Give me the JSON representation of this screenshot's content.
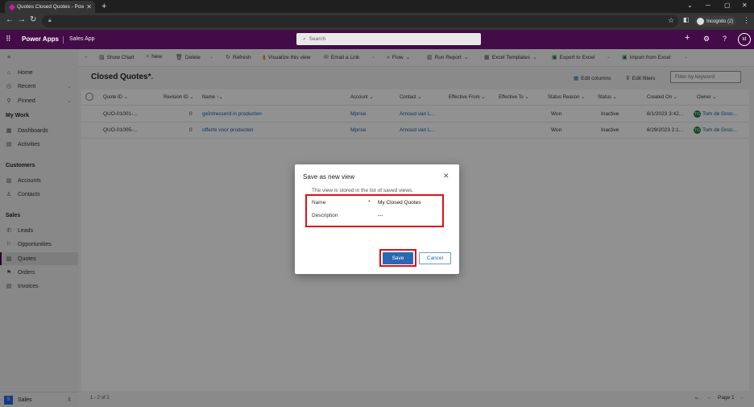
{
  "browser": {
    "tab_title": "Quotes Closed Quotes - Power A",
    "incognito_label": "Incognito (2)"
  },
  "app": {
    "name": "Power Apps",
    "sub_app": "Sales App",
    "search_placeholder": "Search",
    "user_initials": "td"
  },
  "sidebar": {
    "top_items": [
      {
        "label": "Home",
        "icon": "home-icon"
      },
      {
        "label": "Recent",
        "icon": "clock-icon",
        "chevron": true
      },
      {
        "label": "Pinned",
        "icon": "pin-icon",
        "chevron": true
      }
    ],
    "groups": [
      {
        "title": "My Work",
        "items": [
          {
            "label": "Dashboards"
          },
          {
            "label": "Activities"
          }
        ]
      },
      {
        "title": "Customers",
        "items": [
          {
            "label": "Accounts"
          },
          {
            "label": "Contacts"
          }
        ]
      },
      {
        "title": "Sales",
        "items": [
          {
            "label": "Leads"
          },
          {
            "label": "Opportunities"
          },
          {
            "label": "Quotes",
            "selected": true
          },
          {
            "label": "Orders"
          },
          {
            "label": "Invoices"
          }
        ]
      }
    ],
    "area": {
      "badge": "S",
      "label": "Sales"
    }
  },
  "commandbar": {
    "show_chart": "Show Chart",
    "new": "New",
    "delete": "Delete",
    "refresh": "Refresh",
    "visualize": "Visualize this view",
    "email_link": "Email a Link",
    "flow": "Flow",
    "run_report": "Run Report",
    "excel_templates": "Excel Templates",
    "export_excel": "Export to Excel",
    "import_excel": "Import from Excel"
  },
  "view": {
    "title": "Closed Quotes*",
    "edit_columns": "Edit columns",
    "edit_filters": "Edit filters",
    "keyword_placeholder": "Filter by keyword"
  },
  "grid": {
    "columns": [
      "Quote ID",
      "Revision ID",
      "Name",
      "Account",
      "Contact",
      "Effective From",
      "Effective To",
      "Status Reason",
      "Status",
      "Created On",
      "Owner"
    ],
    "rows": [
      {
        "quote_id": "QUO-01001-...",
        "revision": "0",
        "name": "geïntresserd in producten",
        "account": "Mprise",
        "contact": "Arnoud van L...",
        "status_reason": "Won",
        "status": "Inactive",
        "created_on": "6/1/2023 3:42...",
        "owner": "Tom de Groo..."
      },
      {
        "quote_id": "QUO-01005-...",
        "revision": "0",
        "name": "offerte voor producten",
        "account": "Mprise",
        "contact": "Arnoud van L...",
        "status_reason": "Won",
        "status": "Inactive",
        "created_on": "6/29/2023 2:1...",
        "owner": "Tom de Groo..."
      }
    ],
    "record_count": "1 - 2 of 2",
    "page_label": "Page 1"
  },
  "dialog": {
    "title": "Save as new view",
    "description": "The view is stored in the list of saved views.",
    "name_label": "Name",
    "required_mark": "*",
    "name_value": "My Closed Quotes",
    "description_label": "Description",
    "description_value": "---",
    "save": "Save",
    "cancel": "Cancel"
  },
  "colors": {
    "header": "#430b47",
    "save_button": "#2b67b4",
    "highlight": "#e0101a"
  }
}
